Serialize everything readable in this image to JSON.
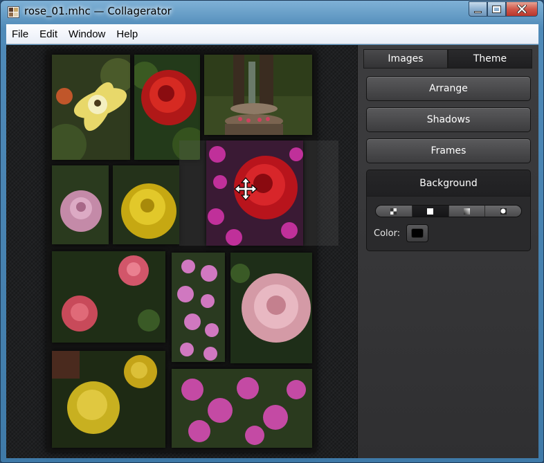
{
  "window": {
    "title": "rose_01.mhc — Collagerator",
    "controls": {
      "minimize": "minimize",
      "maximize": "maximize",
      "close": "close"
    }
  },
  "menu": [
    "File",
    "Edit",
    "Window",
    "Help"
  ],
  "panel": {
    "tabs": [
      {
        "label": "Images",
        "active": false
      },
      {
        "label": "Theme",
        "active": true
      }
    ],
    "buttons": {
      "arrange": "Arrange",
      "shadows": "Shadows",
      "frames": "Frames"
    },
    "background": {
      "title": "Background",
      "modes": [
        {
          "icon": "checker-pattern-icon",
          "active": false
        },
        {
          "icon": "solid-fill-icon",
          "active": true
        },
        {
          "icon": "gradient-fill-icon",
          "active": false
        },
        {
          "icon": "radial-fill-icon",
          "active": false
        }
      ],
      "color_label": "Color:",
      "color_value": "#000000"
    }
  },
  "canvas": {
    "cursor": "move-cursor-icon",
    "photos": [
      {
        "subject": "yellow-white rose"
      },
      {
        "subject": "red rose"
      },
      {
        "subject": "garden fountain"
      },
      {
        "subject": "pink rose"
      },
      {
        "subject": "yellow rose"
      },
      {
        "subject": "pink roses"
      },
      {
        "subject": "pink pentas flowers"
      },
      {
        "subject": "pink camellia"
      },
      {
        "subject": "yellow roses"
      },
      {
        "subject": "magenta flowers"
      }
    ],
    "dragging_photo": {
      "subject": "red rose with magenta flowers"
    }
  },
  "colors": {
    "panel_bg": "#333335",
    "canvas_bg": "#1e1f21",
    "accent": "#ffffff"
  }
}
